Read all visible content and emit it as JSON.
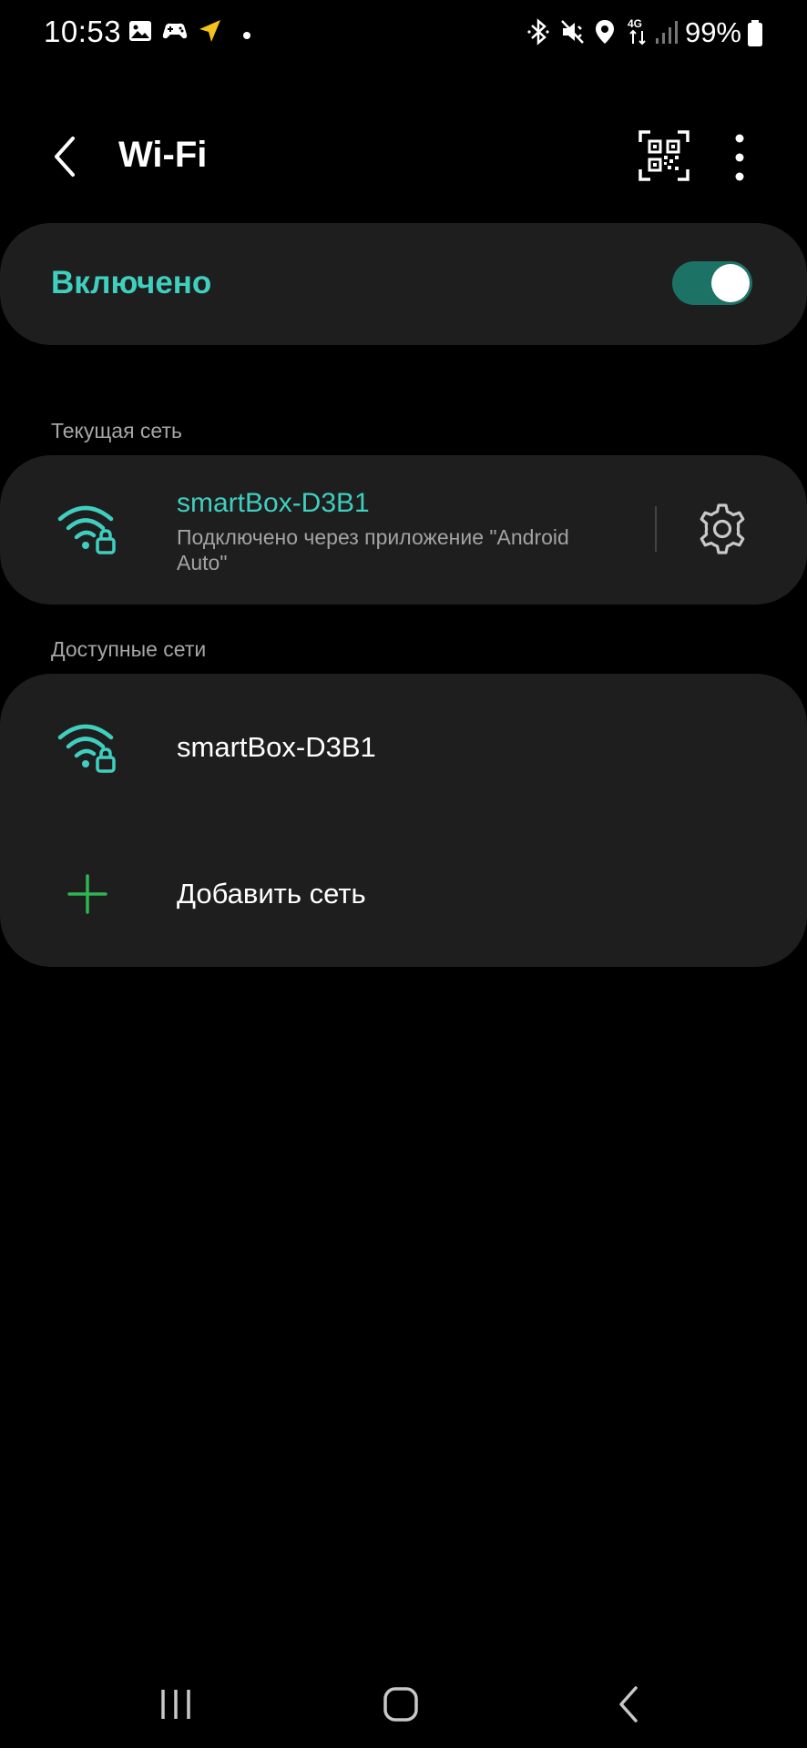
{
  "status_bar": {
    "time": "10:53",
    "battery": "99%",
    "network": "4G",
    "left_icons": [
      "gallery-icon",
      "game-controller-icon",
      "navigation-arrow-icon",
      "dot-icon"
    ],
    "right_icons": [
      "bluetooth-icon",
      "mute-vibrate-icon",
      "location-icon",
      "network-4g-icon",
      "signal-icon",
      "battery-icon"
    ]
  },
  "toolbar": {
    "title": "Wi-Fi",
    "back_icon": "chevron-left-icon",
    "qr_icon": "qr-scan-icon",
    "more_icon": "more-vertical-icon"
  },
  "wifi_toggle": {
    "label": "Включено",
    "on": true
  },
  "current_network": {
    "section_label": "Текущая сеть",
    "name": "smartBox-D3B1",
    "status": "Подключено через приложение \"Android Auto\"",
    "icon": "wifi-locked-icon",
    "settings_icon": "gear-icon"
  },
  "available_networks": {
    "section_label": "Доступные сети",
    "items": [
      {
        "name": "smartBox-D3B1",
        "icon": "wifi-locked-icon"
      }
    ],
    "add_label": "Добавить сеть",
    "add_icon": "plus-icon"
  },
  "colors": {
    "accent": "#3fcfbf",
    "switch_track": "#1d7266",
    "card_bg": "#1e1e1e",
    "add_icon": "#2fb552",
    "background": "#000000"
  },
  "nav_bar": {
    "icons": [
      "recents-icon",
      "home-icon",
      "back-icon"
    ]
  }
}
